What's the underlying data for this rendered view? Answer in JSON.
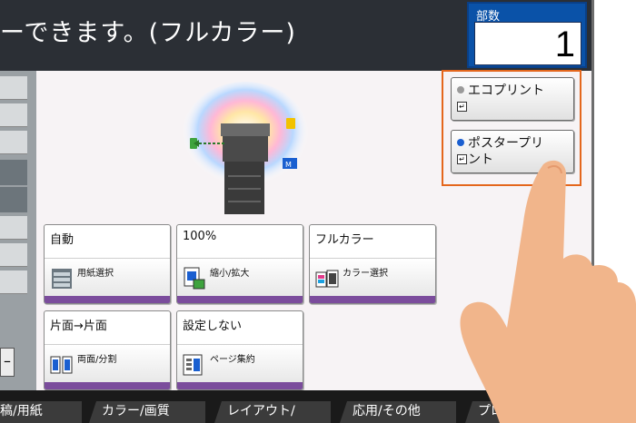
{
  "header": {
    "message": "ーできます。(フルカラー)",
    "copies_label": "部数",
    "copies_value": "1"
  },
  "tiles": [
    {
      "top": "自動",
      "sub": "用紙選択",
      "icon": "paper-select-icon"
    },
    {
      "top": "100%",
      "sub": "縮小/拡大",
      "icon": "zoom-icon"
    },
    {
      "top": "フルカラー",
      "sub": "カラー選択",
      "icon": "color-select-icon"
    },
    {
      "top": "片面→片面",
      "sub": "両面/分割",
      "icon": "duplex-icon"
    },
    {
      "top": "設定しない",
      "sub": "ページ集約",
      "icon": "page-combine-icon"
    }
  ],
  "right_buttons": {
    "eco_print": {
      "line1": "エコプリント",
      "line2": "",
      "dot_color": "#9a9a9a"
    },
    "poster_print": {
      "line1": "ポスタープリ",
      "line2": "ント",
      "dot_color": "#1a5fd0"
    }
  },
  "left_button": "–",
  "tabs": [
    "稿/用紙",
    "カラー/画質",
    "レイアウト/",
    "応用/その他",
    "プログ"
  ],
  "colors": {
    "accent_orange": "#e4661c",
    "copies_blue": "#0a52a8",
    "tile_bar_purple": "#7b4c9c"
  }
}
